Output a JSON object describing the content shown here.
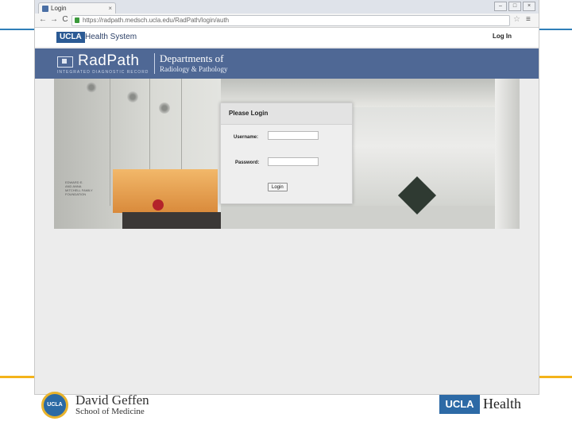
{
  "browser": {
    "tab": {
      "title": "Login",
      "close": "×"
    },
    "window_controls": [
      "–",
      "□",
      "×"
    ],
    "nav": {
      "back": "←",
      "forward": "→",
      "reload": "C"
    },
    "address": {
      "url": "https://radpath.medsch.ucla.edu/RadPath/login/auth"
    },
    "star": "☆",
    "menu": "≡"
  },
  "site": {
    "header": {
      "brand_badge": "UCLA",
      "brand_text": "Health System",
      "login_link": "Log In"
    },
    "banner": {
      "product": "RadPath",
      "product_sub": "INTEGRATED DIAGNOSTIC RECORD",
      "dept_title": "Departments of",
      "dept_sub": "Radiology & Pathology"
    },
    "photo": {
      "sign": [
        "EDWARD E.",
        "AND ANNA",
        "MITCHELL FAMILY",
        "FOUNDATION"
      ]
    },
    "login": {
      "title": "Please Login",
      "username_label": "Username:",
      "username_value": "",
      "password_label": "Password:",
      "password_value": "",
      "button": "Login"
    }
  },
  "slide_footer": {
    "geffen_seal": "UCLA",
    "geffen_title": "David Geffen",
    "geffen_sub": "School of Medicine",
    "health_badge": "UCLA",
    "health_word": "Health"
  },
  "colors": {
    "slide_blue_line": "#2f7fb8",
    "slide_gold_line": "#f3b31a",
    "banner": "#4f6895",
    "ucla_blue": "#2b5a94"
  }
}
